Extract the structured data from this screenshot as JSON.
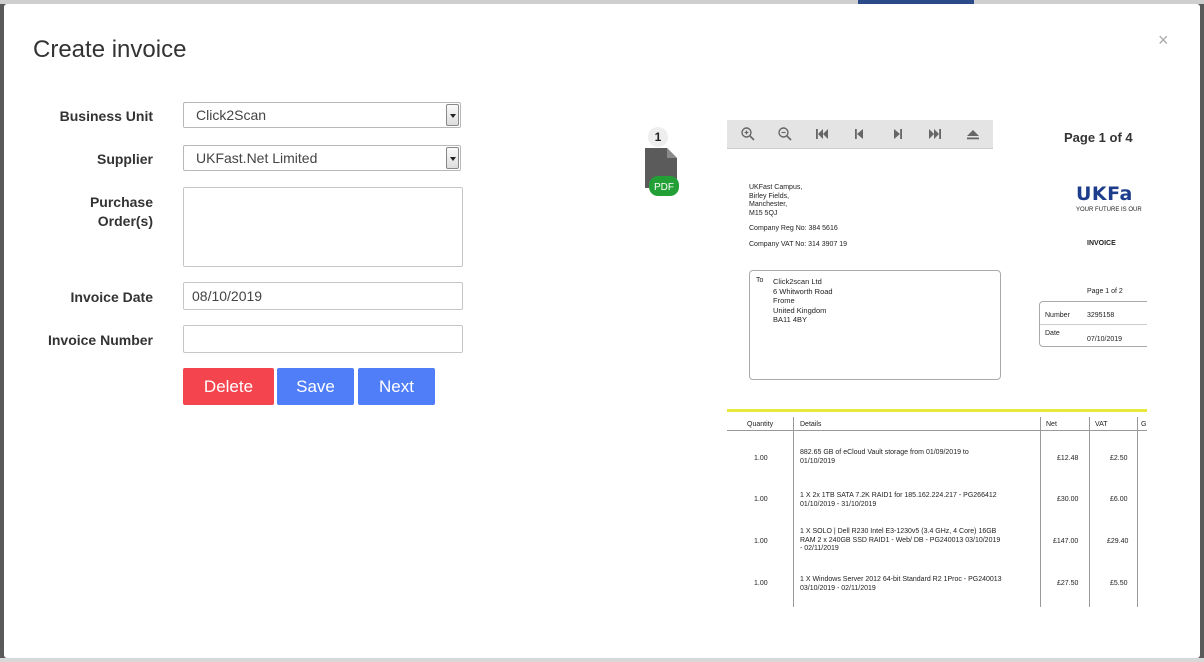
{
  "modal": {
    "title": "Create invoice",
    "close": "×"
  },
  "form": {
    "business_unit_label": "Business Unit",
    "business_unit_value": "Click2Scan",
    "supplier_label": "Supplier",
    "supplier_value": "UKFast.Net Limited",
    "purchase_orders_label_1": "Purchase",
    "purchase_orders_label_2": "Order(s)",
    "purchase_orders_value": "",
    "invoice_date_label": "Invoice Date",
    "invoice_date_value": "08/10/2019",
    "invoice_number_label": "Invoice Number",
    "invoice_number_value": ""
  },
  "buttons": {
    "delete": "Delete",
    "save": "Save",
    "next": "Next"
  },
  "files": {
    "count": "1",
    "type_label": "PDF"
  },
  "viewer": {
    "page_indicator": "Page 1 of 4",
    "toolbar_icons": [
      "zoom-in-icon",
      "zoom-out-icon",
      "first-page-icon",
      "prev-page-icon",
      "next-page-icon",
      "last-page-icon",
      "eject-icon"
    ]
  },
  "document": {
    "address_lines": [
      "UKFast Campus,",
      "Birley Fields,",
      "Manchester,",
      "M15 5QJ"
    ],
    "company_reg": "Company Reg No: 384 5616",
    "company_vat": "Company VAT No: 314 3907 19",
    "logo": "UKFa",
    "logo_tagline": "YOUR FUTURE IS OUR",
    "heading": "INVOICE",
    "to_label": "To",
    "to_lines": [
      "Click2scan Ltd",
      "6 Whitworth Road",
      "Frome",
      "United Kingdom",
      "BA11 4BY"
    ],
    "page_of": "Page 1 of 2",
    "number_label": "Number",
    "number_value": "3295158",
    "date_label": "Date",
    "date_value": "07/10/2019",
    "columns": [
      "Quantity",
      "Details",
      "Net",
      "VAT",
      "G"
    ],
    "rows": [
      {
        "qty": "1.00",
        "details_1": "882.65 GB of eCloud Vault storage from 01/09/2019 to",
        "details_2": "01/10/2019",
        "details_3": "",
        "net": "£12.48",
        "vat": "£2.50"
      },
      {
        "qty": "1.00",
        "details_1": "1 X 2x 1TB SATA 7.2K RAID1 for 185.162.224.217 - PG266412",
        "details_2": "01/10/2019 - 31/10/2019",
        "details_3": "",
        "net": "£30.00",
        "vat": "£6.00"
      },
      {
        "qty": "1.00",
        "details_1": "1 X SOLO | Dell R230 Intel E3-1230v5 (3.4 GHz, 4 Core) 16GB",
        "details_2": "RAM 2 x 240GB SSD RAID1 - Web/ DB - PG240013 03/10/2019",
        "details_3": "- 02/11/2019",
        "net": "£147.00",
        "vat": "£29.40"
      },
      {
        "qty": "1.00",
        "details_1": "1 X Windows Server 2012 64-bit Standard R2 1Proc - PG240013",
        "details_2": "03/10/2019 - 02/11/2019",
        "details_3": "",
        "net": "£27.50",
        "vat": "£5.50"
      }
    ]
  },
  "colors": {
    "danger": "#f4454f",
    "primary": "#4f7ef8",
    "pdf_badge": "#22a035",
    "accent_line": "#e6e83a"
  }
}
